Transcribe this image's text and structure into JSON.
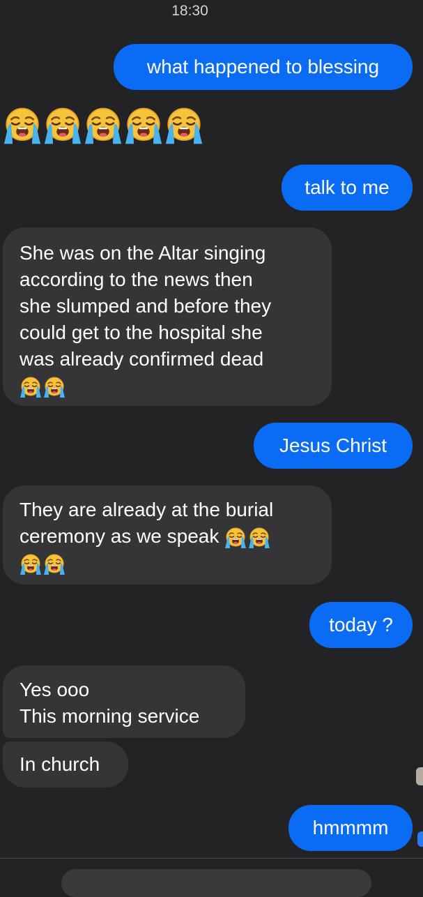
{
  "status": {
    "time": "18:30"
  },
  "messages": [
    {
      "id": "m1",
      "direction": "outgoing",
      "text": "what happened to blessing"
    },
    {
      "id": "m2",
      "direction": "incoming",
      "emoji_only": true,
      "emoji": [
        "loudly-crying-face",
        "loudly-crying-face",
        "loudly-crying-face",
        "loudly-crying-face",
        "loudly-crying-face"
      ]
    },
    {
      "id": "m3",
      "direction": "outgoing",
      "text": "talk to me"
    },
    {
      "id": "m4",
      "direction": "incoming",
      "lines": [
        "She was on the Altar singing",
        "according to the news then",
        "she slumped and before they",
        "could get to the hospital she",
        "was already confirmed dead"
      ],
      "emoji": [
        "loudly-crying-face",
        "loudly-crying-face"
      ]
    },
    {
      "id": "m5",
      "direction": "outgoing",
      "text": "Jesus Christ"
    },
    {
      "id": "m6",
      "direction": "incoming",
      "lines": [
        "They are already at the burial",
        "ceremony as we speak"
      ],
      "emoji": [
        "loudly-crying-face",
        "loudly-crying-face",
        "loudly-crying-face",
        "loudly-crying-face"
      ]
    },
    {
      "id": "m7",
      "direction": "outgoing",
      "text": "today ?"
    },
    {
      "id": "m8",
      "direction": "incoming",
      "lines": [
        "Yes ooo",
        "This morning service"
      ]
    },
    {
      "id": "m9",
      "direction": "incoming",
      "text": "In church"
    },
    {
      "id": "m10",
      "direction": "outgoing",
      "text": "hmmmm"
    }
  ],
  "colors": {
    "background": "#232325",
    "outgoing_bubble": "#0a6cf5",
    "incoming_bubble": "#353537",
    "emoji_face": "#f7c33a"
  }
}
